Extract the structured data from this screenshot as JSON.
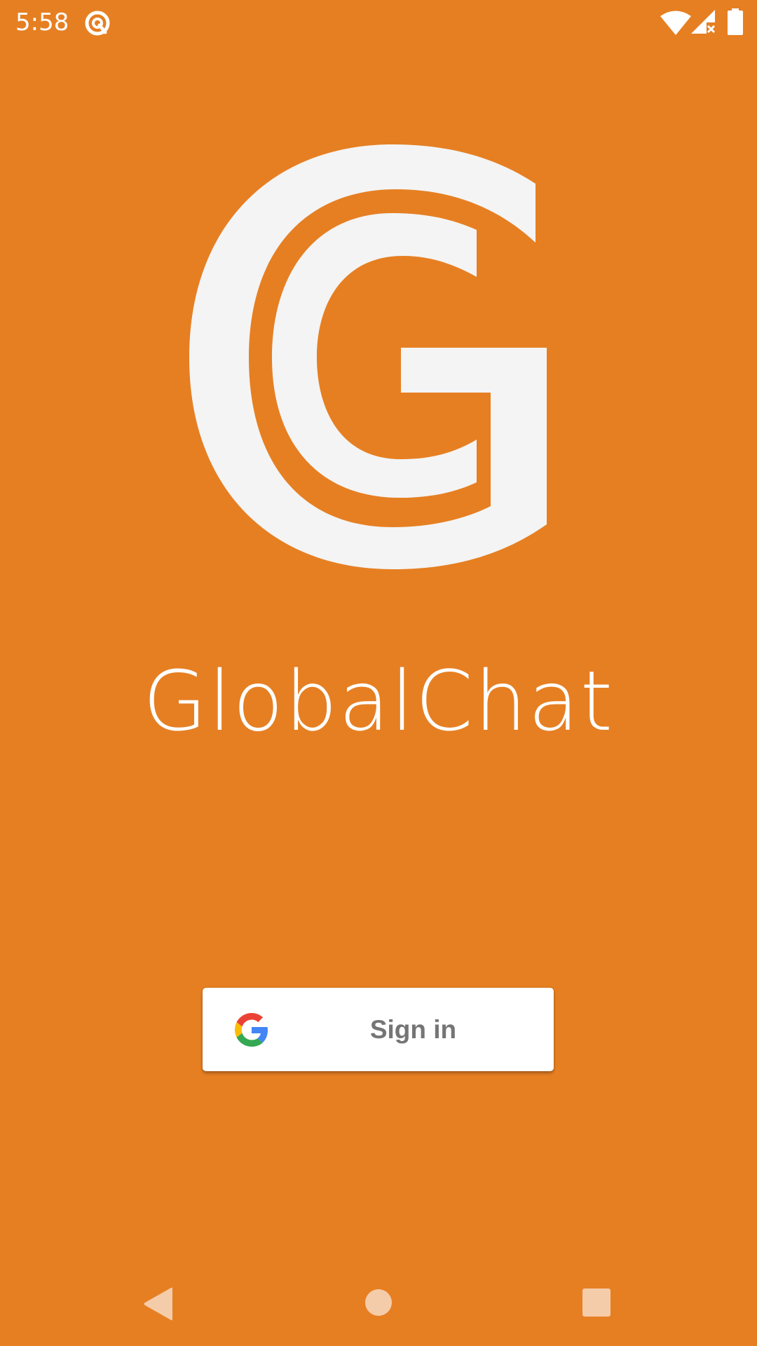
{
  "colors": {
    "background": "#e67f22",
    "foreground": "#ffffff",
    "logo": "#f4f4f4",
    "button_text": "#757575",
    "nav_icon": "#f5ccaa"
  },
  "status_bar": {
    "time": "5:58",
    "icons": [
      "data-saver-icon",
      "wifi-icon",
      "cell-signal-no-service-icon",
      "battery-icon"
    ]
  },
  "app": {
    "name": "GlobalChat",
    "logo_icon": "globalchat-g-logo"
  },
  "signin": {
    "label": "Sign in",
    "icon": "google-g-icon"
  },
  "nav_bar": {
    "buttons": [
      "back-icon",
      "home-icon",
      "recents-icon"
    ]
  }
}
